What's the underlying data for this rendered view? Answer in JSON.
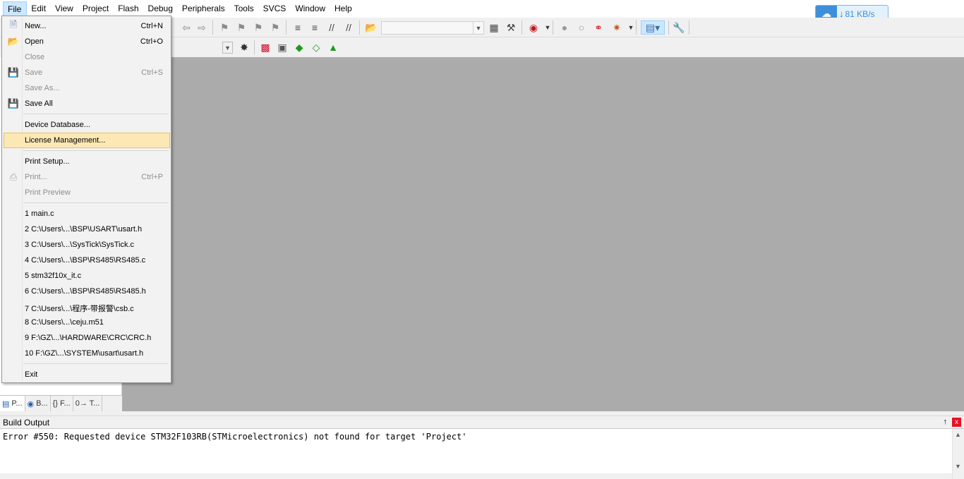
{
  "menubar": {
    "items": [
      "File",
      "Edit",
      "View",
      "Project",
      "Flash",
      "Debug",
      "Peripherals",
      "Tools",
      "SVCS",
      "Window",
      "Help"
    ],
    "active": "File"
  },
  "download_speed": "81 KB/s",
  "file_menu": {
    "group1": [
      {
        "label": "New...",
        "shortcut": "Ctrl+N",
        "enabled": true,
        "icon": "new-file-icon"
      },
      {
        "label": "Open",
        "shortcut": "Ctrl+O",
        "enabled": true,
        "icon": "open-folder-icon"
      },
      {
        "label": "Close",
        "shortcut": "",
        "enabled": false,
        "icon": ""
      },
      {
        "label": "Save",
        "shortcut": "Ctrl+S",
        "enabled": false,
        "icon": "save-icon"
      },
      {
        "label": "Save As...",
        "shortcut": "",
        "enabled": false,
        "icon": ""
      },
      {
        "label": "Save All",
        "shortcut": "",
        "enabled": true,
        "icon": "save-all-icon"
      }
    ],
    "group2": [
      {
        "label": "Device Database...",
        "shortcut": "",
        "enabled": true
      },
      {
        "label": "License Management...",
        "shortcut": "",
        "enabled": true,
        "highlighted": true
      }
    ],
    "group3": [
      {
        "label": "Print Setup...",
        "shortcut": "",
        "enabled": true
      },
      {
        "label": "Print...",
        "shortcut": "Ctrl+P",
        "enabled": false,
        "icon": "print-icon"
      },
      {
        "label": "Print Preview",
        "shortcut": "",
        "enabled": false
      }
    ],
    "recent_files": [
      "1 main.c",
      "2 C:\\Users\\...\\BSP\\USART\\usart.h",
      "3 C:\\Users\\...\\SysTick\\SysTick.c",
      "4 C:\\Users\\...\\BSP\\RS485\\RS485.c",
      "5 stm32f10x_it.c",
      "6 C:\\Users\\...\\BSP\\RS485\\RS485.h",
      "7 C:\\Users\\...\\程序-带报警\\csb.c",
      "8 C:\\Users\\...\\ceju.m51",
      "9 F:\\GZ\\...\\HARDWARE\\CRC\\CRC.h",
      "10 F:\\GZ\\...\\SYSTEM\\usart\\usart.h"
    ],
    "exit": "Exit"
  },
  "left_panel_tabs": [
    "P...",
    "B...",
    "{} F...",
    "0→ T..."
  ],
  "build_output": {
    "title": "Build Output",
    "pin": "↑",
    "close": "x",
    "text": "Error #550: Requested device STM32F103RB(STMicroelectronics) not found for target 'Project'"
  }
}
